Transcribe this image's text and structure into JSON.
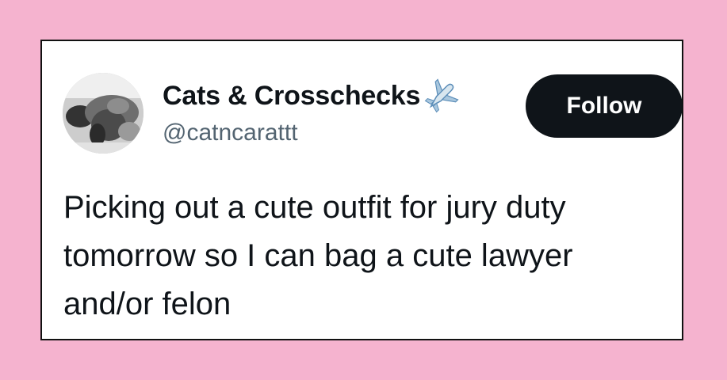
{
  "tweet": {
    "display_name": "Cats & Crosschecks",
    "handle": "@catncarattt",
    "follow_label": "Follow",
    "text": "Picking out a cute outfit for jury duty tomorrow so I can bag a cute lawyer and/or felon",
    "name_emoji_icon": "airplane-icon"
  },
  "colors": {
    "background": "#f5b3cf",
    "card": "#ffffff",
    "text": "#0f1419",
    "secondary_text": "#536471",
    "button": "#0f1419"
  }
}
